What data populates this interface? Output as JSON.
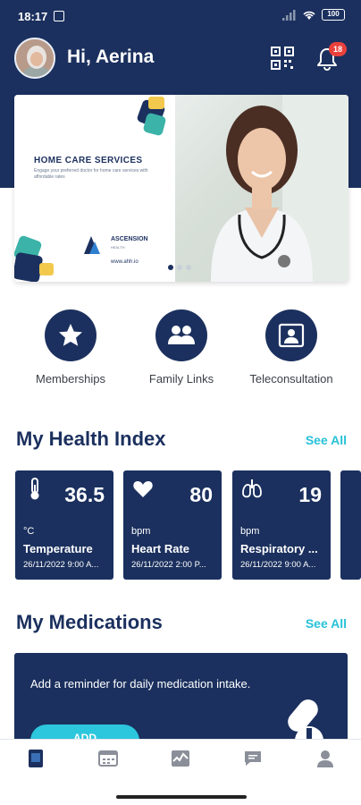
{
  "status_bar": {
    "time": "18:17",
    "battery": "100"
  },
  "header": {
    "greeting": "Hi, Aerina",
    "notification_count": "18"
  },
  "banner": {
    "title": "HOME CARE SERVICES",
    "subtitle": "Engage your preferred doctor for home care services with affordable rates",
    "brand": "ASCENSION",
    "brand_sub": "HEALTH",
    "url": "www.ahh.io"
  },
  "quick_actions": [
    {
      "label": "Memberships",
      "icon": "star-icon"
    },
    {
      "label": "Family Links",
      "icon": "people-icon"
    },
    {
      "label": "Teleconsultation",
      "icon": "video-portrait-icon"
    }
  ],
  "health_index": {
    "title": "My Health Index",
    "see_all": "See All",
    "cards": [
      {
        "icon": "thermometer-icon",
        "value": "36.5",
        "unit": "°C",
        "name": "Temperature",
        "date": "26/11/2022 9:00 A..."
      },
      {
        "icon": "heart-icon",
        "value": "80",
        "unit": "bpm",
        "name": "Heart Rate",
        "date": "26/11/2022 2:00 P..."
      },
      {
        "icon": "lungs-icon",
        "value": "19",
        "unit": "bpm",
        "name": "Respiratory ...",
        "date": "26/11/2022 9:00 A..."
      }
    ]
  },
  "medications": {
    "title": "My Medications",
    "see_all": "See All",
    "reminder_text": "Add a reminder for daily medication intake.",
    "add_button": "ADD"
  },
  "bottom_nav": [
    {
      "icon": "home-card-icon",
      "active": true
    },
    {
      "icon": "calendar-icon",
      "active": false
    },
    {
      "icon": "chart-icon",
      "active": false
    },
    {
      "icon": "chat-icon",
      "active": false
    },
    {
      "icon": "profile-icon",
      "active": false
    }
  ],
  "colors": {
    "primary": "#1b305e",
    "accent": "#27c1d8",
    "badge": "#e8413c"
  }
}
